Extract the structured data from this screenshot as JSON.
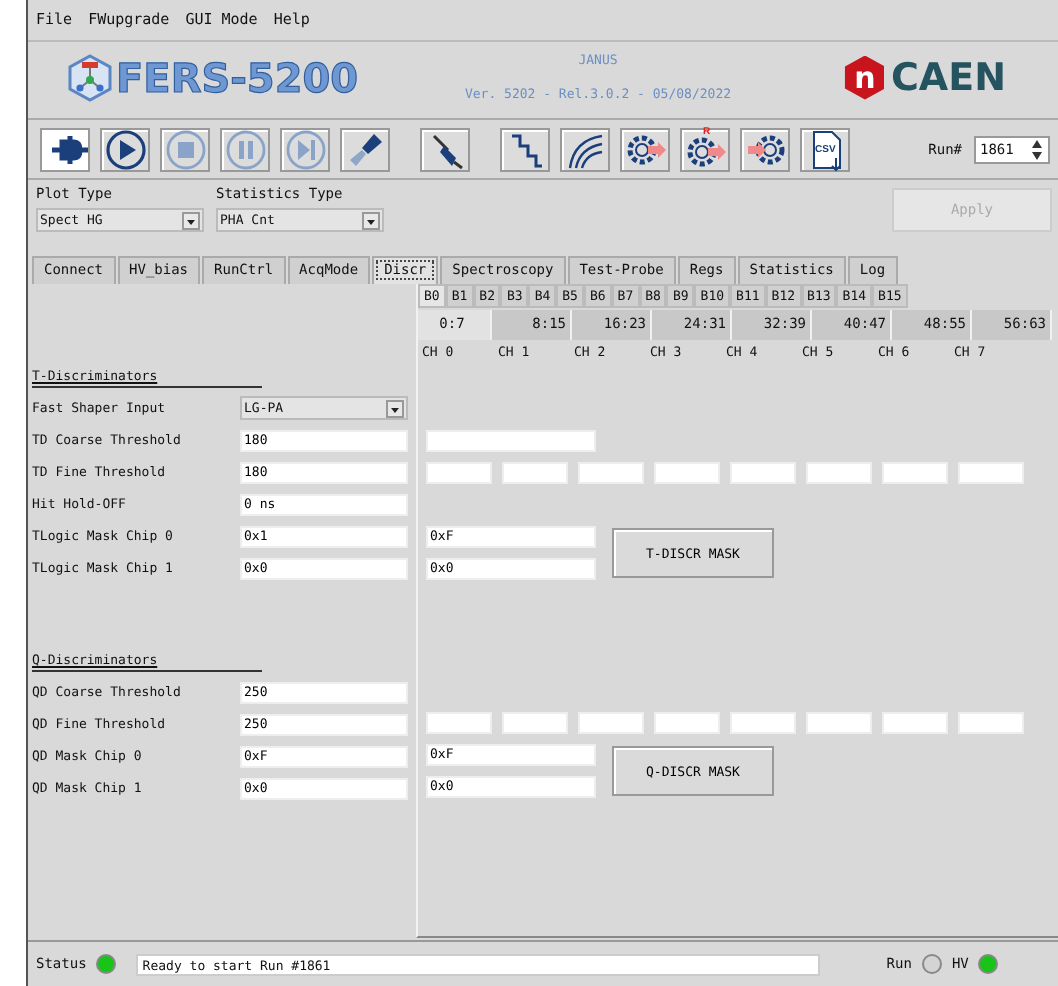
{
  "menu": [
    "File",
    "FWupgrade",
    "GUI Mode",
    "Help"
  ],
  "header": {
    "product": "FERS-5200",
    "app": "JANUS",
    "version": "Ver. 5202 - Rel.3.0.2 - 05/08/2022",
    "brand_mark": "n",
    "brand": "CAEN"
  },
  "toolbar": [
    {
      "kind": "plug",
      "pressed": true,
      "disabled": false
    },
    {
      "kind": "play",
      "pressed": false,
      "disabled": false
    },
    {
      "kind": "stop",
      "pressed": false,
      "disabled": true
    },
    {
      "kind": "pause",
      "pressed": false,
      "disabled": true
    },
    {
      "kind": "step",
      "pressed": false,
      "disabled": true
    },
    {
      "kind": "brush",
      "pressed": false,
      "disabled": false
    },
    {
      "kind": "probe",
      "pressed": false,
      "disabled": false
    },
    {
      "kind": "staircase",
      "pressed": false,
      "disabled": false
    },
    {
      "kind": "curves",
      "pressed": false,
      "disabled": false
    },
    {
      "kind": "gear",
      "pressed": false,
      "disabled": false
    },
    {
      "kind": "gear_r",
      "label": "R",
      "pressed": false,
      "disabled": false
    },
    {
      "kind": "gear_in",
      "pressed": false,
      "disabled": false
    },
    {
      "kind": "csv",
      "label": "CSV",
      "pressed": false,
      "disabled": false
    }
  ],
  "run": {
    "label": "Run#",
    "value": "1861"
  },
  "plot_type": {
    "label": "Plot Type",
    "value": "Spect HG"
  },
  "statistics_type": {
    "label": "Statistics Type",
    "value": "PHA Cnt"
  },
  "apply_button": {
    "label": "Apply",
    "disabled": true
  },
  "tabs": [
    {
      "label": "Connect",
      "selected": false
    },
    {
      "label": "HV_bias",
      "selected": false
    },
    {
      "label": "RunCtrl",
      "selected": false
    },
    {
      "label": "AcqMode",
      "selected": false
    },
    {
      "label": "Discr",
      "selected": true
    },
    {
      "label": "Spectroscopy",
      "selected": false
    },
    {
      "label": "Test-Probe",
      "selected": false
    },
    {
      "label": "Regs",
      "selected": false
    },
    {
      "label": "Statistics",
      "selected": false
    },
    {
      "label": "Log",
      "selected": false
    }
  ],
  "board_tabs": [
    {
      "label": "B0",
      "selected": true
    },
    {
      "label": "B1",
      "selected": false
    },
    {
      "label": "B2",
      "selected": false
    },
    {
      "label": "B3",
      "selected": false
    },
    {
      "label": "B4",
      "selected": false
    },
    {
      "label": "B5",
      "selected": false
    },
    {
      "label": "B6",
      "selected": false
    },
    {
      "label": "B7",
      "selected": false
    },
    {
      "label": "B8",
      "selected": false
    },
    {
      "label": "B9",
      "selected": false
    },
    {
      "label": "B10",
      "selected": false
    },
    {
      "label": "B11",
      "selected": false
    },
    {
      "label": "B12",
      "selected": false
    },
    {
      "label": "B13",
      "selected": false
    },
    {
      "label": "B14",
      "selected": false
    },
    {
      "label": "B15",
      "selected": false
    }
  ],
  "channel_tabs": [
    {
      "label": "0:7",
      "selected": true
    },
    {
      "label": "8:15",
      "selected": false
    },
    {
      "label": "16:23",
      "selected": false
    },
    {
      "label": "24:31",
      "selected": false
    },
    {
      "label": "32:39",
      "selected": false
    },
    {
      "label": "40:47",
      "selected": false
    },
    {
      "label": "48:55",
      "selected": false
    },
    {
      "label": "56:63",
      "selected": false
    }
  ],
  "channels": [
    "CH 0",
    "CH 1",
    "CH 2",
    "CH 3",
    "CH 4",
    "CH 5",
    "CH 6",
    "CH 7"
  ],
  "sections": [
    {
      "title": "T-Discriminators",
      "button": "T-DISCR MASK",
      "rows": [
        {
          "label": "Fast Shaper Input",
          "kind": "dropdown",
          "value": "LG-PA"
        },
        {
          "label": "TD Coarse Threshold",
          "kind": "field",
          "value": "180",
          "right": {
            "kind": "field"
          }
        },
        {
          "label": "TD Fine Threshold",
          "kind": "field",
          "value": "180",
          "right": {
            "kind": "channel_fields"
          }
        },
        {
          "label": "Hit Hold-OFF",
          "kind": "field",
          "value": "0 ns"
        },
        {
          "label": "TLogic Mask Chip 0",
          "kind": "field",
          "value": "0x1",
          "right": {
            "kind": "field",
            "value": "0xF"
          }
        },
        {
          "label": "TLogic Mask Chip 1",
          "kind": "field",
          "value": "0x0",
          "right": {
            "kind": "field",
            "value": "0x0"
          }
        }
      ]
    },
    {
      "title": "Q-Discriminators",
      "button": "Q-DISCR MASK",
      "rows": [
        {
          "label": "QD Coarse Threshold",
          "kind": "field",
          "value": "250"
        },
        {
          "label": "QD Fine Threshold",
          "kind": "field",
          "value": "250",
          "right": {
            "kind": "channel_fields"
          }
        },
        {
          "label": "QD Mask Chip 0",
          "kind": "field",
          "value": "0xF",
          "right": {
            "kind": "field",
            "value": "0xF"
          }
        },
        {
          "label": "QD Mask Chip 1",
          "kind": "field",
          "value": "0x0",
          "right": {
            "kind": "field",
            "value": "0x0"
          }
        }
      ]
    }
  ],
  "status_bar": {
    "status": {
      "label": "Status",
      "color": "#19c419"
    },
    "message": "Ready to start Run #1861",
    "indicators": [
      {
        "label": "Run",
        "color": "#d4d4d4"
      },
      {
        "label": "HV",
        "color": "#19c419"
      }
    ]
  }
}
